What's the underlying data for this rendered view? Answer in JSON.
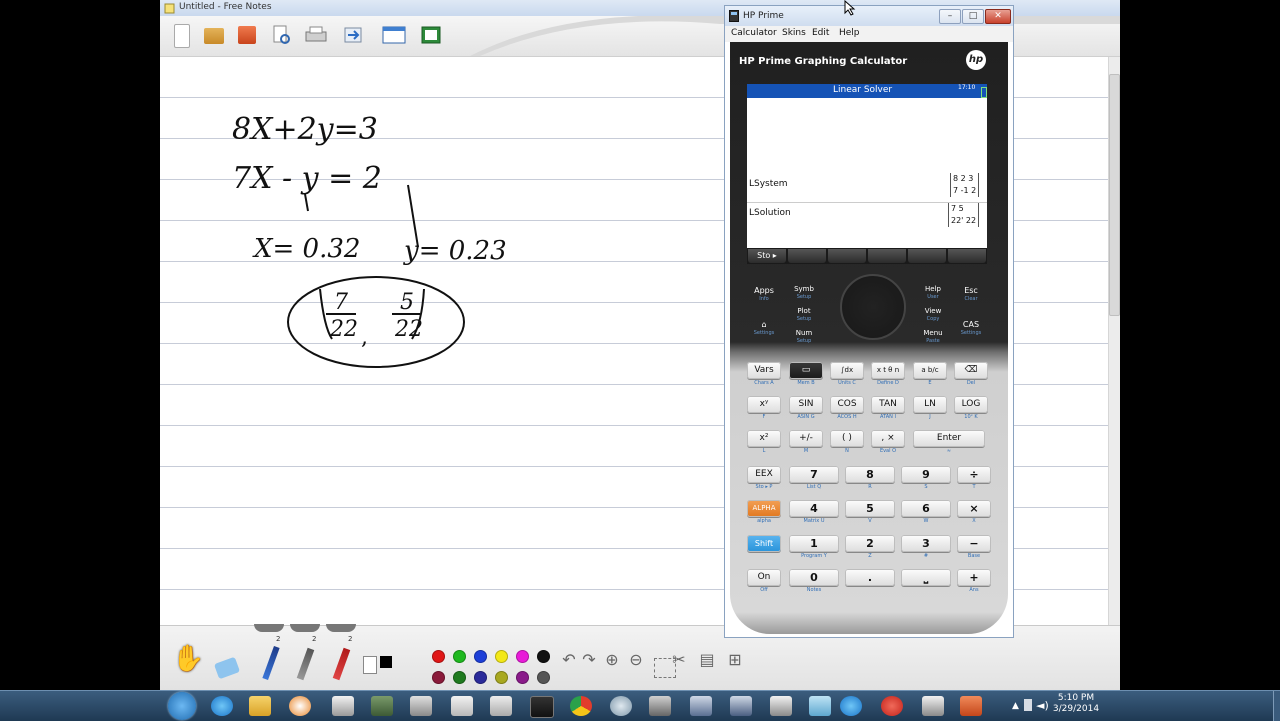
{
  "notes": {
    "title": "Untitled - Free Notes",
    "handwriting": {
      "eq1": "8X+2y=3",
      "eq2": "7X - y = 2",
      "x_result": "X= 0.32",
      "y_result": "y= 0.23",
      "fraction1_num": "7",
      "fraction1_den": "22",
      "fraction2_num": "5",
      "fraction2_den": "22"
    },
    "pen_sizes": [
      "2",
      "2",
      "2"
    ],
    "colors": [
      "#e01616",
      "#1fb81f",
      "#1d3fd8",
      "#f3e817",
      "#e81bd8",
      "#111111",
      "#8a1a3a",
      "#1f7a1f",
      "#2a2a9a",
      "#a8a820",
      "#8a1a8a",
      "#555555"
    ]
  },
  "hp": {
    "title": "HP Prime",
    "menu": [
      "Calculator",
      "Skins",
      "Edit",
      "Help"
    ],
    "brand": "HP Prime Graphing Calculator",
    "logo": "hp",
    "screen": {
      "header": "Linear Solver",
      "time": "17:10",
      "lsystem_label": "LSystem",
      "lsystem_row1": "8  2  3",
      "lsystem_row2": "7 -1  2",
      "lsolution_label": "LSolution",
      "lsolution_row1": "7   5",
      "lsolution_row2": "22' 22",
      "softkey1": "Sto ▸"
    },
    "top_keys": {
      "apps": "Apps",
      "apps_sub": "Info",
      "home_sub": "Settings",
      "symb": "Symb",
      "symb_sub": "Setup",
      "plot": "Plot",
      "plot_sub": "Setup",
      "num": "Num",
      "num_sub": "Setup",
      "help": "Help",
      "help_sub": "User",
      "view": "View",
      "view_sub": "Copy",
      "menu": "Menu",
      "menu_sub": "Paste",
      "esc": "Esc",
      "esc_sub": "Clear",
      "cas": "CAS",
      "cas_sub": "Settings"
    },
    "keys": [
      {
        "label": "Vars",
        "sub": "Chars A"
      },
      {
        "label": "▭",
        "sub": "Mem B"
      },
      {
        "label": "∫dx",
        "sub": "Units C"
      },
      {
        "label": "x t θ n",
        "sub": "Define D"
      },
      {
        "label": "a b/c",
        "sub": "E"
      },
      {
        "label": "⌫",
        "sub": "Del"
      },
      {
        "label": "xʸ",
        "sub": "F"
      },
      {
        "label": "SIN",
        "sub": "ASIN G"
      },
      {
        "label": "COS",
        "sub": "ACOS H"
      },
      {
        "label": "TAN",
        "sub": "ATAN I"
      },
      {
        "label": "LN",
        "sub": "J"
      },
      {
        "label": "LOG",
        "sub": "10ˣ K"
      },
      {
        "label": "x²",
        "sub": "L"
      },
      {
        "label": "+/-",
        "sub": "M"
      },
      {
        "label": "( )",
        "sub": "N"
      },
      {
        "label": ", ×",
        "sub": "Eval O"
      },
      {
        "label": "Enter",
        "sub": "≈"
      },
      {
        "label": "EEX",
        "sub": "Sto ▸ P"
      },
      {
        "label": "7",
        "sub": "List Q"
      },
      {
        "label": "8",
        "sub": "R"
      },
      {
        "label": "9",
        "sub": "S"
      },
      {
        "label": "÷",
        "sub": "T"
      },
      {
        "label": "ALPHA",
        "sub": "alpha"
      },
      {
        "label": "4",
        "sub": "Matrix U"
      },
      {
        "label": "5",
        "sub": "V"
      },
      {
        "label": "6",
        "sub": "W"
      },
      {
        "label": "×",
        "sub": "X"
      },
      {
        "label": "Shift",
        "sub": ""
      },
      {
        "label": "1",
        "sub": "Program Y"
      },
      {
        "label": "2",
        "sub": "Z"
      },
      {
        "label": "3",
        "sub": "#"
      },
      {
        "label": "−",
        "sub": "Base"
      },
      {
        "label": "On",
        "sub": "Off"
      },
      {
        "label": "0",
        "sub": "Notes"
      },
      {
        "label": ".",
        "sub": ""
      },
      {
        "label": "⎵",
        "sub": ""
      },
      {
        "label": "+",
        "sub": "Ans"
      }
    ]
  },
  "taskbar": {
    "time": "5:10 PM",
    "date": "3/29/2014"
  }
}
